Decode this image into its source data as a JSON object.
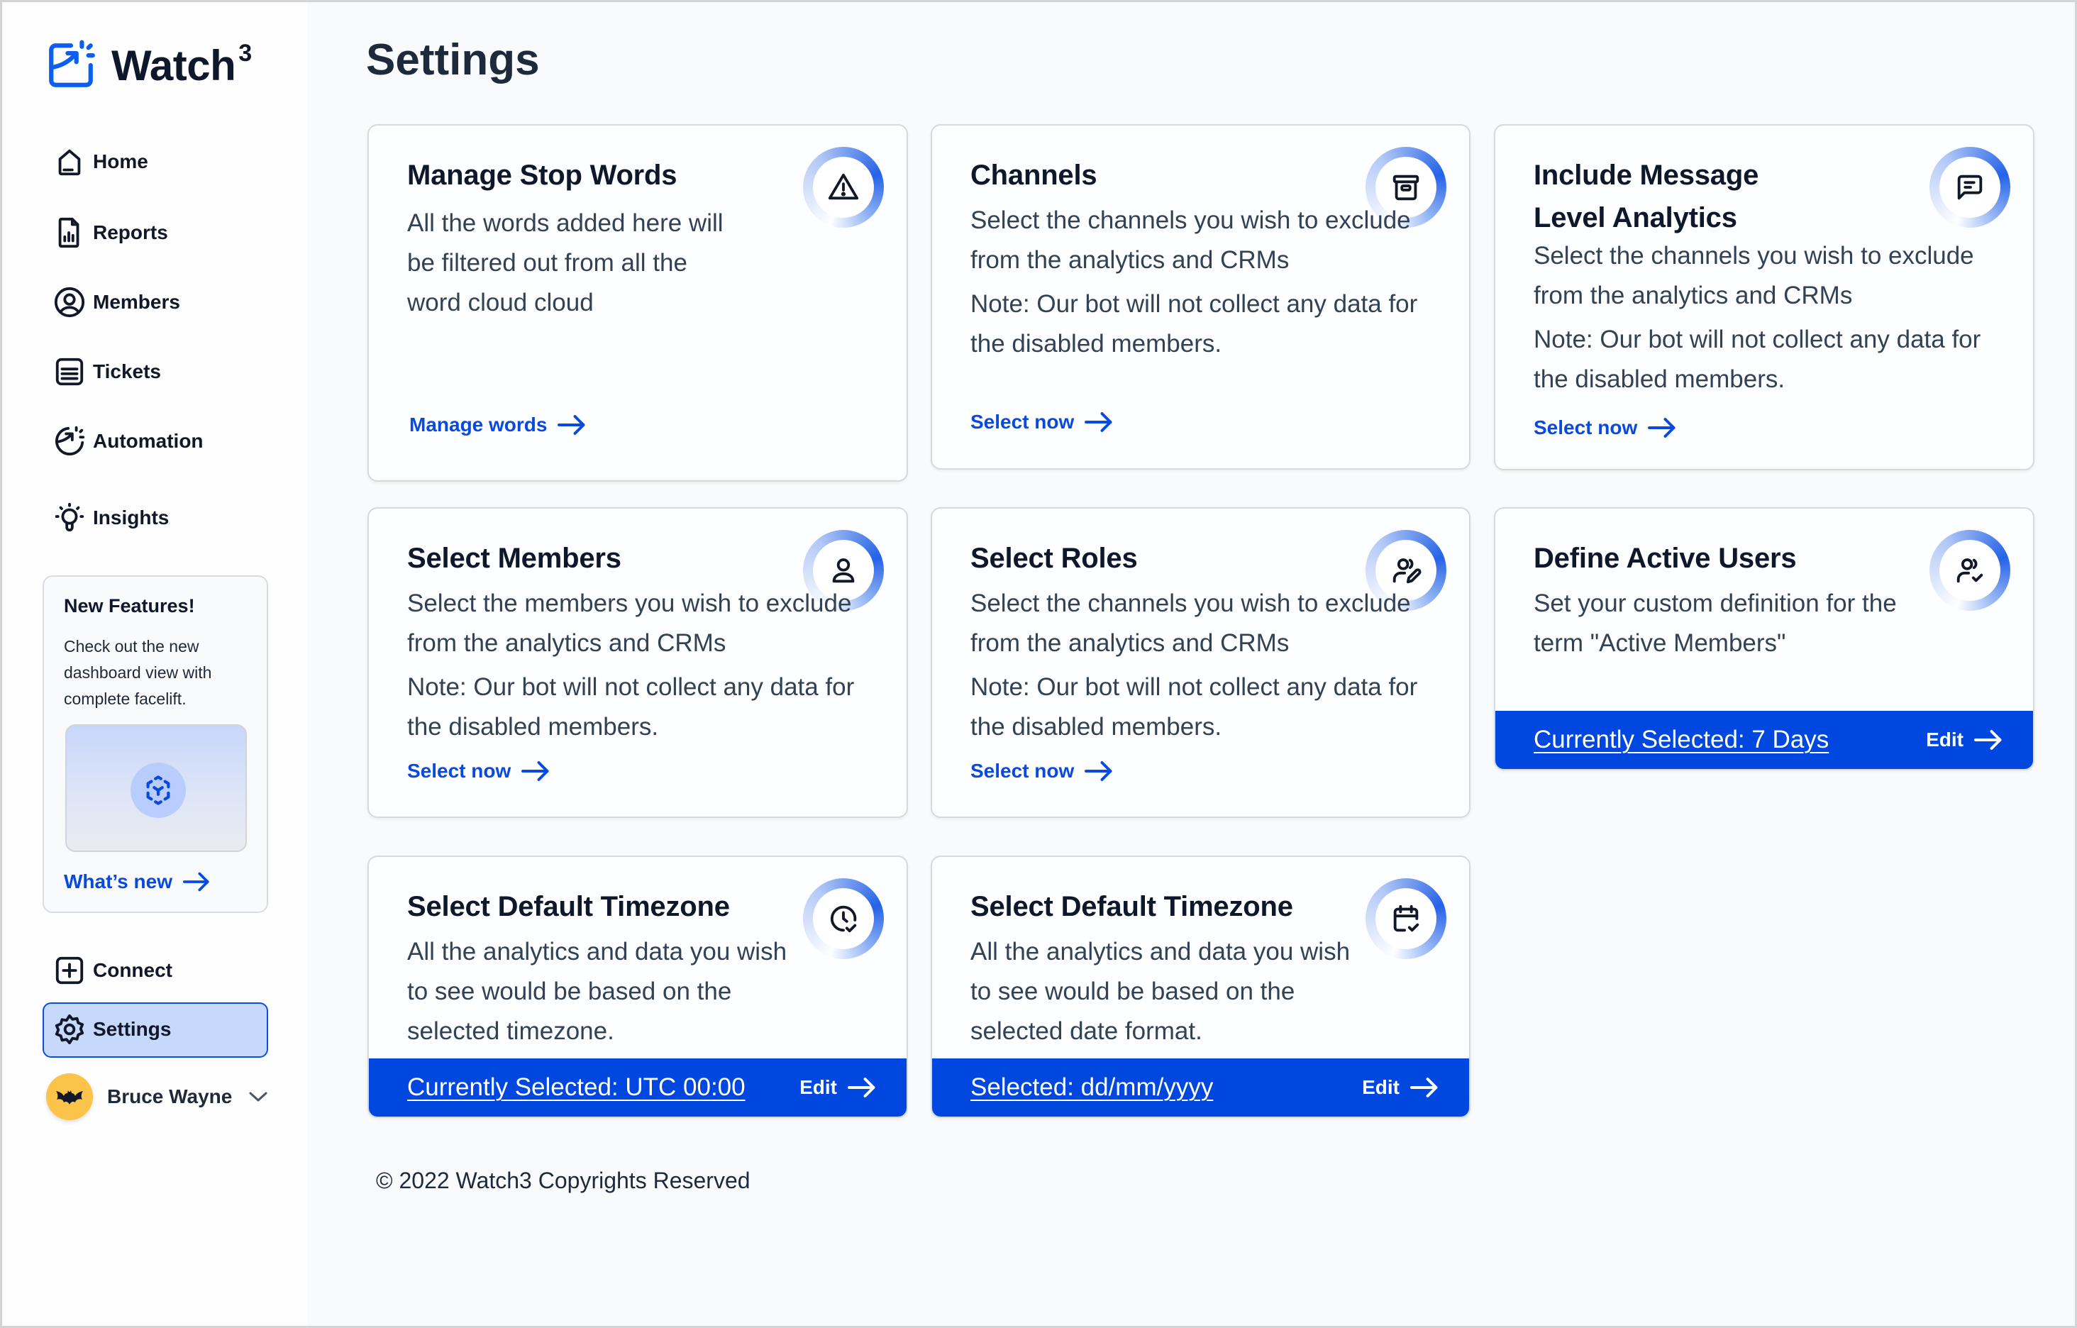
{
  "app": {
    "name": "Watch",
    "name_superscript": "3"
  },
  "sidebar": {
    "nav": [
      {
        "label": "Home",
        "icon": "home-icon"
      },
      {
        "label": "Reports",
        "icon": "report-file-icon"
      },
      {
        "label": "Members",
        "icon": "user-circle-icon"
      },
      {
        "label": "Tickets",
        "icon": "ticket-list-icon"
      },
      {
        "label": "Automation",
        "icon": "automation-icon"
      },
      {
        "label": "Insights",
        "icon": "lightbulb-icon"
      }
    ],
    "promo": {
      "title": "New Features!",
      "text": "Check out the new dashboard view with complete facelift.",
      "link": "What’s new",
      "icon": "cube-icon"
    },
    "bottom_nav": [
      {
        "label": "Connect",
        "icon": "plus-square-icon",
        "active": false
      },
      {
        "label": "Settings",
        "icon": "gear-icon",
        "active": true
      }
    ],
    "user": {
      "name": "Bruce Wayne",
      "avatar": "batman-avatar"
    }
  },
  "main": {
    "title": "Settings",
    "cards": [
      {
        "title": "Manage Stop Words",
        "body": [
          "All the words added here will be filtered out from all the word cloud cloud"
        ],
        "link": "Manage words",
        "icon": "warning-triangle-icon"
      },
      {
        "title": "Channels",
        "body": [
          "Select the channels you wish to exclude from the analytics and CRMs",
          "Note: Our bot will not collect any data for the disabled members."
        ],
        "link": "Select now",
        "icon": "archive-box-icon"
      },
      {
        "title": "Include Message Level Analytics",
        "body": [
          "Select the channels you wish to exclude from the analytics and CRMs",
          "Note: Our bot will not collect any data for the disabled members."
        ],
        "link": "Select now",
        "icon": "message-icon"
      },
      {
        "title": "Select Members",
        "body": [
          "Select the members you wish to exclude from the analytics and CRMs",
          "Note: Our bot will not collect any data for the disabled members."
        ],
        "link": "Select now",
        "icon": "user-icon"
      },
      {
        "title": "Select Roles",
        "body": [
          "Select the channels you wish to exclude from the analytics and CRMs",
          "Note: Our bot will not collect any data for the disabled members."
        ],
        "link": "Select now",
        "icon": "user-edit-icon"
      },
      {
        "title": "Define Active Users",
        "body": [
          "Set your custom definition for the term \"Active Members\""
        ],
        "selected": "Currently Selected: 7 Days",
        "edit": "Edit",
        "icon": "user-check-icon"
      },
      {
        "title": "Select Default Timezone",
        "body": [
          "All the analytics and data you wish to see would be based on the selected timezone."
        ],
        "selected": "Currently Selected: UTC 00:00",
        "edit": "Edit",
        "icon": "clock-check-icon"
      },
      {
        "title": "Select Default Timezone",
        "body": [
          "All the analytics and data you wish to see would be based on the selected date format."
        ],
        "selected": "Selected: dd/mm/yyyy",
        "edit": "Edit",
        "icon": "calendar-check-icon"
      }
    ],
    "footer": "© 2022 Watch3 Copyrights Reserved"
  },
  "colors": {
    "accent": "#0047e0",
    "link": "#0849e0",
    "text": "#0f172a",
    "body_text": "#334155",
    "active_nav_bg": "#c7d8fd",
    "avatar_bg": "#fbc34a",
    "background": "#f8fafc"
  }
}
